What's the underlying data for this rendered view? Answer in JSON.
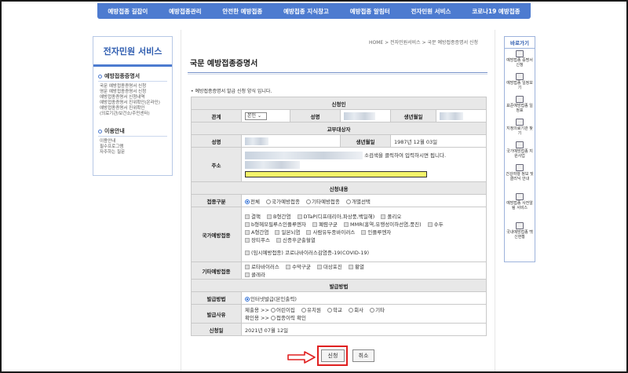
{
  "top_nav": [
    "예방접종 길잡이",
    "예방접종관리",
    "안전한 예방접종",
    "예방접종 지식창고",
    "예방접종 알림터",
    "전자민원 서비스",
    "코로나19 예방접종"
  ],
  "sidebar": {
    "title": "전자민원 서비스",
    "section1": "예방접종증명서",
    "items1": [
      "국문 예방접종증명서 신청",
      "영문 예방접종증명서 신청",
      "예방접종증명서 신청내역",
      "예방접종증명서 진위확인(온라인)",
      "예방접종증명서 진위확인",
      "(의료기관/보건소/주민센터)"
    ],
    "section2": "이용안내",
    "items2": [
      "이용안내",
      "필수프로그램",
      "자주하는 질문"
    ]
  },
  "breadcrumb": "HOME > 전자민원서비스 > 국문 예방접종증명서 신청",
  "page_title": "국문 예방접종증명서",
  "notice": "• 예방접종증명서 발급 신청 양식 입니다.",
  "form": {
    "applicant_header": "신청인",
    "relation_label": "관계",
    "relation_value": "본인",
    "name_label": "성명",
    "birth_label": "생년월일",
    "target_header": "교부대상자",
    "target_birth_value": "1987년 12월 03일",
    "address_label": "주소",
    "address_hint": "소검색을 클릭하여 입력하시면 됩니다.",
    "details_header": "신청내용",
    "vtype_label": "접종구분",
    "vtype_options": [
      "전체",
      "국가예방접종",
      "기타예방접종",
      "개별선택"
    ],
    "national_label": "국가예방접종",
    "national_line1": [
      "결핵",
      "B형간염",
      "DTaP(디프테리아,파상풍,백일해)",
      "폴리오"
    ],
    "national_line2": [
      "b형헤모필루스인플루엔자",
      "폐렴구균",
      "MMR(홍역,유행성이하선염,풍진)",
      "수두"
    ],
    "national_line3": [
      "A형간염",
      "일본뇌염",
      "사람유두종바이러스",
      "인플루엔자"
    ],
    "national_line4": [
      "장티푸스",
      "신증후군출혈열"
    ],
    "national_line5": "(임시예방접종) 코로나바이러스감염증-19(COVID-19)",
    "other_label": "기타예방접종",
    "other_line1": [
      "로타바이러스",
      "수막구균",
      "대상포진",
      "황열"
    ],
    "other_line2": [
      "콜레라"
    ],
    "issue_header": "발급방법",
    "issue_method_label": "발급방법",
    "issue_method_value": "인터넷발급(본인출력)",
    "reason_label": "발급사유",
    "reason_line1_prefix": "제출용 >>",
    "reason_line1": [
      "어린이집",
      "유치원",
      "학교",
      "회사",
      "기타"
    ],
    "reason_line2_prefix": "확인용 >>",
    "reason_line2": [
      "접종이력 확인"
    ],
    "date_label": "신청일",
    "date_value": "2021년 07월 12일"
  },
  "buttons": {
    "apply": "신청",
    "cancel": "취소"
  },
  "quick": {
    "title": "바로가기",
    "items": [
      "예방접종 증명서 신청",
      "예방접종 일정보기",
      "표준예방접종 일정표",
      "지정의료기관 찾기",
      "국가예방접종 지원사업",
      "건강여행 정보 및 클리닉 안내",
      "예방접종 사전알림 서비스",
      "국내예방접종 백신현황"
    ]
  },
  "colors": {
    "nav": "#4d7bd0",
    "highlight": "#e02020",
    "address_highlight": "#f4f46a"
  }
}
